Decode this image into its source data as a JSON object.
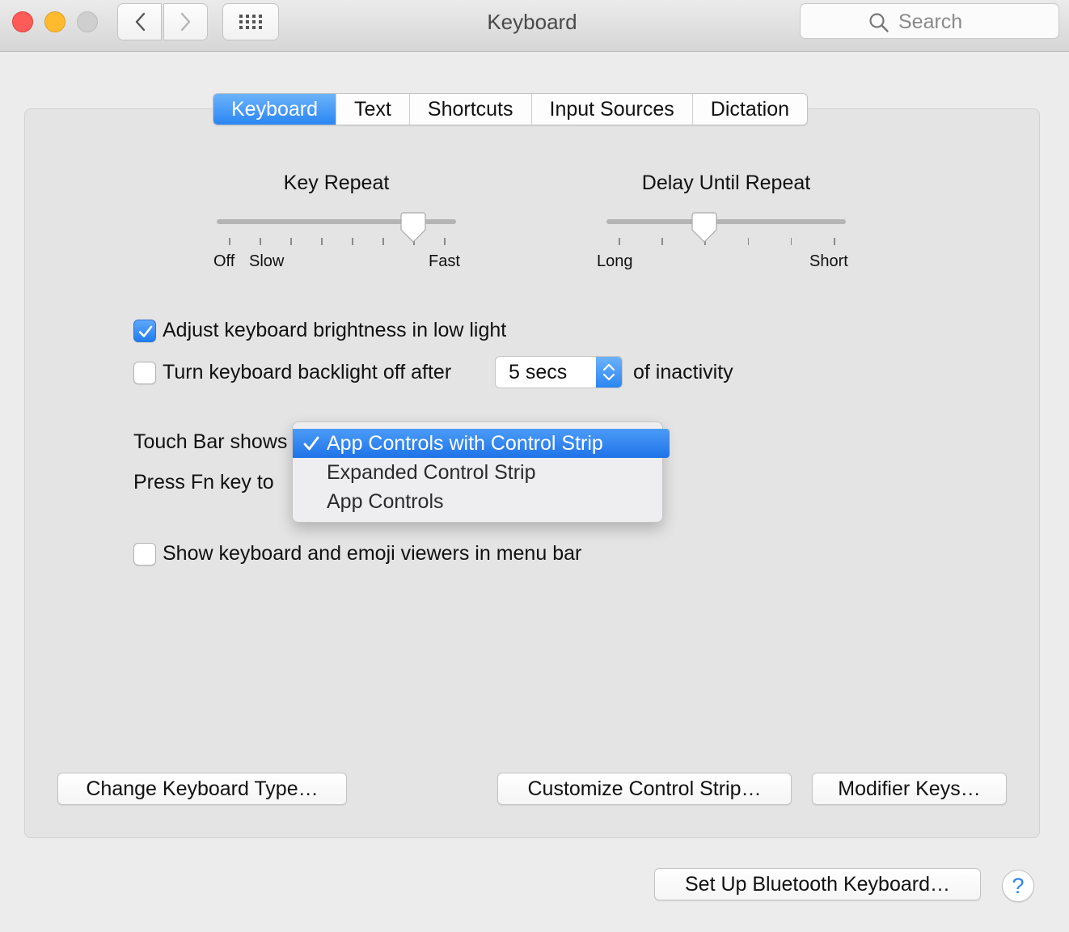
{
  "window": {
    "title": "Keyboard"
  },
  "search": {
    "placeholder": "Search"
  },
  "tabs": [
    {
      "label": "Keyboard",
      "active": true
    },
    {
      "label": "Text",
      "active": false
    },
    {
      "label": "Shortcuts",
      "active": false
    },
    {
      "label": "Input Sources",
      "active": false
    },
    {
      "label": "Dictation",
      "active": false
    }
  ],
  "key_repeat": {
    "title": "Key Repeat",
    "labels": {
      "off": "Off",
      "slow": "Slow",
      "fast": "Fast"
    },
    "tick_count": 8,
    "value_index": 6
  },
  "delay_until_repeat": {
    "title": "Delay Until Repeat",
    "labels": {
      "long": "Long",
      "short": "Short"
    },
    "tick_count": 6,
    "value_index": 2
  },
  "options": {
    "adjust_brightness": {
      "label": "Adjust keyboard brightness in low light",
      "checked": true
    },
    "backlight_off": {
      "label": "Turn keyboard backlight off after",
      "checked": false,
      "suffix": "of inactivity"
    },
    "backlight_timeout": {
      "value": "5 secs"
    },
    "show_viewers": {
      "label": "Show keyboard and emoji viewers in menu bar",
      "checked": false
    }
  },
  "touch_bar": {
    "shows_label": "Touch Bar shows",
    "fn_label": "Press Fn key to",
    "menu": {
      "selected": "App Controls with Control Strip",
      "items": [
        "App Controls with Control Strip",
        "Expanded Control Strip",
        "App Controls"
      ]
    }
  },
  "buttons": {
    "change_keyboard_type": "Change Keyboard Type…",
    "customize_control_strip": "Customize Control Strip…",
    "modifier_keys": "Modifier Keys…",
    "setup_bluetooth": "Set Up Bluetooth Keyboard…",
    "help": "?"
  },
  "colors": {
    "accent": "#2a86f3",
    "close": "#fc5b57",
    "minimize": "#fdbb2d"
  }
}
